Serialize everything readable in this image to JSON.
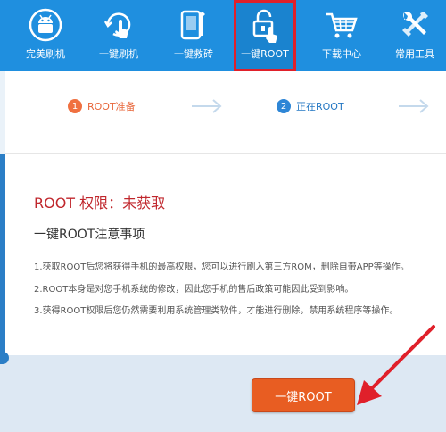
{
  "toolbar": {
    "items": [
      {
        "label": "完美刷机",
        "icon": "android-robot-icon"
      },
      {
        "label": "一键刷机",
        "icon": "touch-refresh-icon"
      },
      {
        "label": "一键救砖",
        "icon": "phone-wrench-icon"
      },
      {
        "label": "一键ROOT",
        "icon": "unlock-icon",
        "active": true
      },
      {
        "label": "下载中心",
        "icon": "cart-icon"
      },
      {
        "label": "常用工具",
        "icon": "tools-icon"
      }
    ]
  },
  "steps": {
    "step1": {
      "num": "1",
      "label": "ROOT准备"
    },
    "step2": {
      "num": "2",
      "label": "正在ROOT"
    }
  },
  "content": {
    "status": "ROOT 权限：未获取",
    "notice_title": "一键ROOT注意事项",
    "items": [
      "1.获取ROOT后您将获得手机的最高权限，您可以进行刷入第三方ROM，删除自带APP等操作。",
      "2.ROOT本身是对您手机系统的修改，因此您手机的售后政策可能因此受到影响。",
      "3.获得ROOT权限后您仍然需要利用系统管理类软件，才能进行删除，禁用系统程序等操作。"
    ],
    "button": "一键ROOT"
  },
  "colors": {
    "toolbar": "#1f8fdf",
    "highlight": "#e0202a",
    "button": "#e85d22",
    "status": "#c0272d"
  }
}
